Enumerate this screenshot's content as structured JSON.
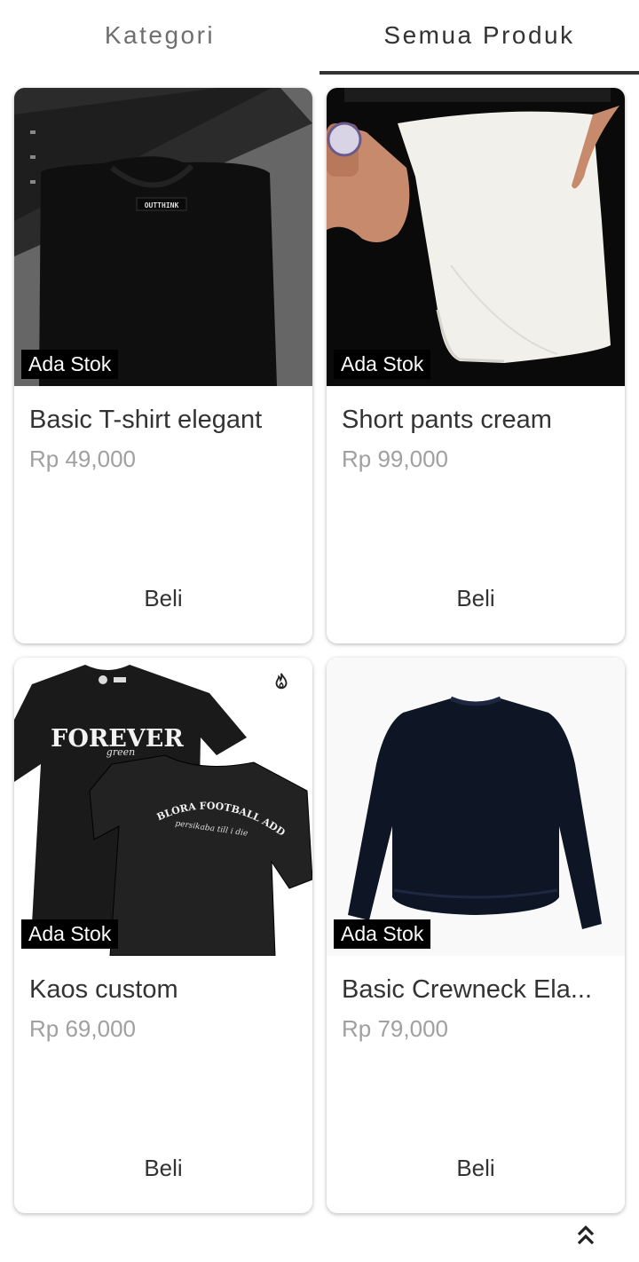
{
  "tabs": {
    "kategori": "Kategori",
    "semua_produk": "Semua Produk",
    "active": "semua_produk"
  },
  "products": [
    {
      "name": "Basic T-shirt elegant",
      "price": "Rp 49,000",
      "stock": "Ada Stok",
      "buy": "Beli",
      "image": "black folded t-shirt with OUTTHINK label",
      "label_text": "OUTTHINK"
    },
    {
      "name": "Short pants cream",
      "price": "Rp 99,000",
      "stock": "Ada Stok",
      "buy": "Beli",
      "image": "person wearing cream shorts"
    },
    {
      "name": "Kaos custom",
      "price": "Rp 69,000",
      "stock": "Ada Stok",
      "buy": "Beli",
      "image": "two black custom t-shirts",
      "shirt_front": "FOREVER",
      "shirt_front_sub": "green",
      "shirt_back": "BLORA FOOTBALL ADDICT",
      "shirt_back_sub": "persikaba till i die",
      "badge_icon": "fire-icon"
    },
    {
      "name": "Basic Crewneck Ela...",
      "price": "Rp 79,000",
      "stock": "Ada Stok",
      "buy": "Beli",
      "image": "navy crewneck sweater"
    }
  ],
  "scroll_top_icon": "double-chevron-up-icon",
  "colors": {
    "text": "#333333",
    "price": "#a0a0a0",
    "stock_bg": "#000000",
    "tab_indicator": "#333333"
  }
}
